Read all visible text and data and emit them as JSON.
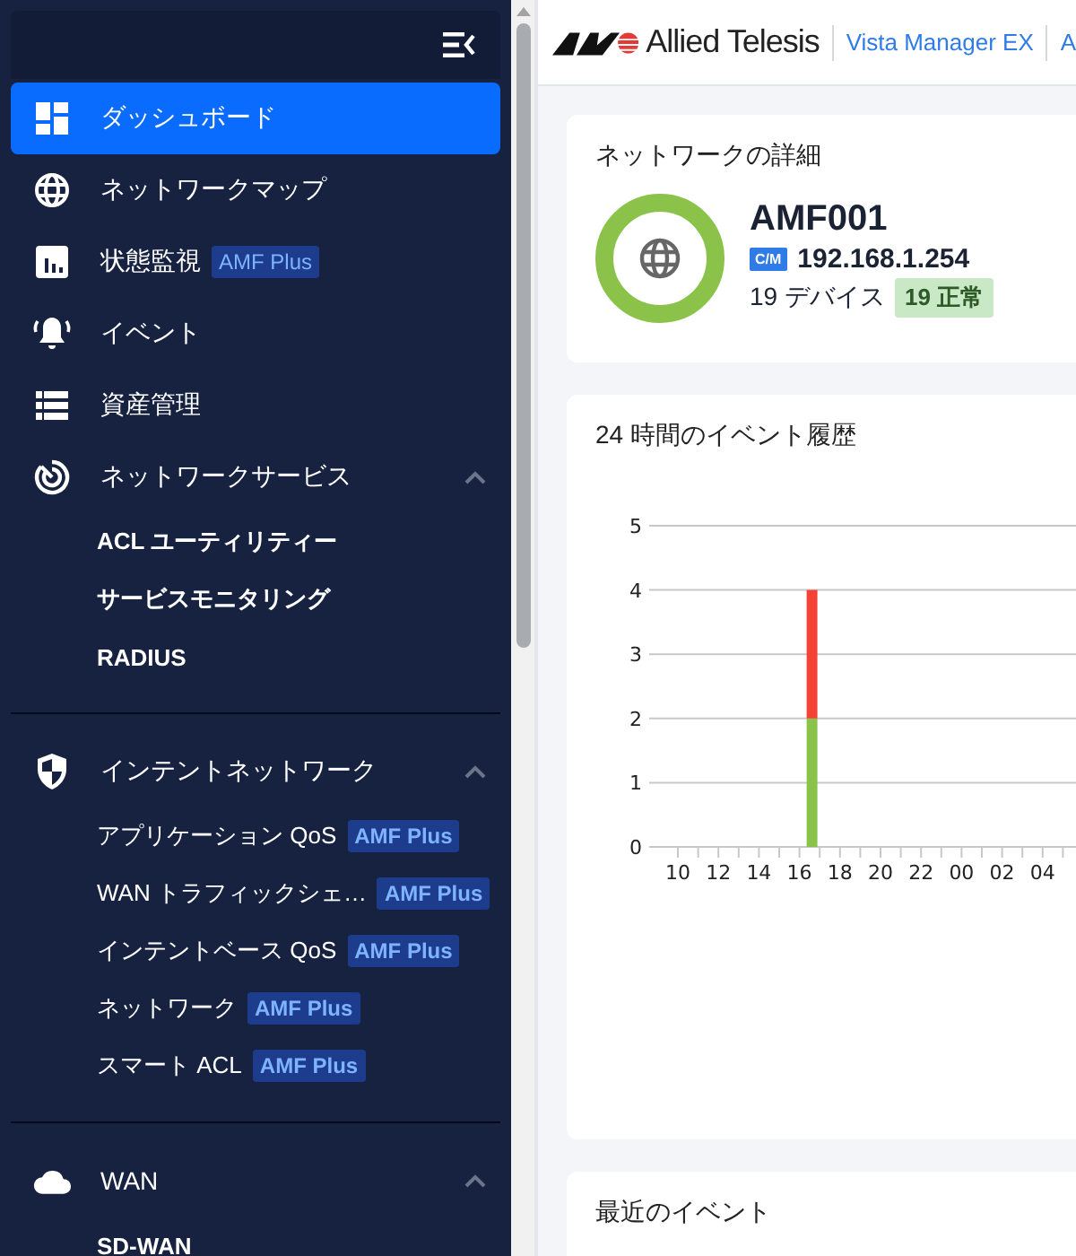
{
  "sidebar": {
    "sections": [
      {
        "items": [
          {
            "label": "ダッシュボード",
            "selected": true
          },
          {
            "label": "ネットワークマップ",
            "selected": false
          },
          {
            "label": "状態監視",
            "badge": "AMF Plus",
            "selected": false
          },
          {
            "label": "イベント",
            "selected": false
          },
          {
            "label": "資産管理",
            "selected": false
          },
          {
            "label": "ネットワークサービス",
            "selected": false,
            "expanded": true,
            "children": [
              {
                "label": "ACL ユーティリティー",
                "selected": false
              },
              {
                "label": "サービスモニタリング",
                "selected": false
              },
              {
                "label": "RADIUS",
                "selected": false
              }
            ]
          }
        ]
      },
      {
        "items": [
          {
            "label": "インテントネットワーク",
            "selected": false,
            "expanded": true,
            "children": [
              {
                "label": "アプリケーション QoS",
                "badge": "AMF Plus",
                "selected": false
              },
              {
                "label": "WAN トラフィックシェ…",
                "badge": "AMF Plus",
                "selected": false
              },
              {
                "label": "インテントベース QoS",
                "badge": "AMF Plus",
                "selected": false
              },
              {
                "label": "ネットワーク",
                "badge": "AMF Plus",
                "selected": false
              },
              {
                "label": "スマート ACL",
                "badge": "AMF Plus",
                "selected": false
              }
            ]
          }
        ]
      },
      {
        "items": [
          {
            "label": "WAN",
            "selected": false,
            "expanded": true,
            "children": [
              {
                "label": "SD-WAN",
                "selected": false
              }
            ]
          }
        ]
      }
    ]
  },
  "header": {
    "brand": "Allied Telesis",
    "product": "Vista Manager EX",
    "next": "A"
  },
  "network_details": {
    "title": "ネットワークの詳細",
    "name": "AMF001",
    "role": "C/M",
    "address": "192.168.1.254",
    "devices": "19 デバイス",
    "status": "19 正常"
  },
  "event_history": {
    "title": "24 時間のイベント履歴",
    "chart_data": {
      "type": "bar",
      "stacked": true,
      "categories": [
        "10",
        "12",
        "14",
        "16",
        "18",
        "20",
        "22",
        "00",
        "02",
        "04"
      ],
      "series": [
        {
          "color": "#8bc34a",
          "values": [
            0,
            0,
            0,
            2,
            0,
            0,
            0,
            0,
            0,
            0
          ]
        },
        {
          "color": "#f44336",
          "values": [
            0,
            0,
            0,
            2,
            0,
            0,
            0,
            0,
            0,
            0
          ]
        }
      ],
      "ylim": [
        0,
        5
      ],
      "yticks": [
        0,
        1,
        2,
        3,
        4,
        5
      ],
      "grid": true
    }
  },
  "recent_events": {
    "title": "最近のイベント"
  }
}
